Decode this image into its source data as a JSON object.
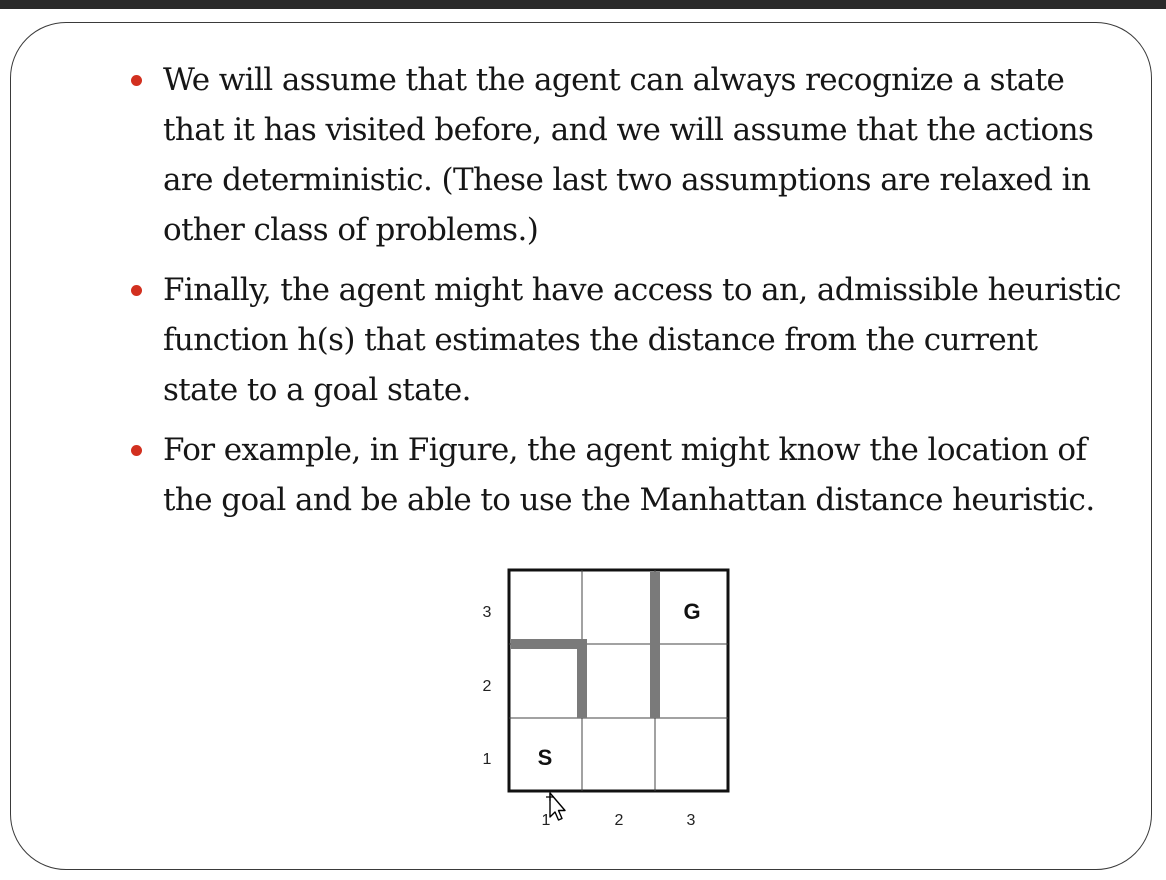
{
  "slide": {
    "bullets": [
      {
        "lines": [
          "We will assume that the agent can always recognize a state",
          "that it has visited before, and we will assume that the actions",
          "are deterministic. (These last two assumptions are relaxed in",
          "other class of problems.)"
        ]
      },
      {
        "lines": [
          "Finally, the agent might have access to an, admissible heuristic",
          "function h(s) that estimates the distance from the current",
          "state to a goal state."
        ]
      },
      {
        "lines": [
          "For example, in Figure, the agent might know the location of",
          "the goal and be able to use the Manhattan distance heuristic."
        ]
      }
    ],
    "bullet_color": "#d2301f"
  },
  "figure": {
    "grid": {
      "rows": 3,
      "cols": 3
    },
    "row_labels": [
      "3",
      "2",
      "1"
    ],
    "col_labels": [
      "1",
      "2",
      "3"
    ],
    "cells": {
      "start": {
        "label": "S",
        "col": 1,
        "row": 1
      },
      "goal": {
        "label": "G",
        "col": 3,
        "row": 3
      }
    },
    "wall_color": "#7a7a7a"
  },
  "cursor": {
    "icon": "pointer-move-icon"
  }
}
